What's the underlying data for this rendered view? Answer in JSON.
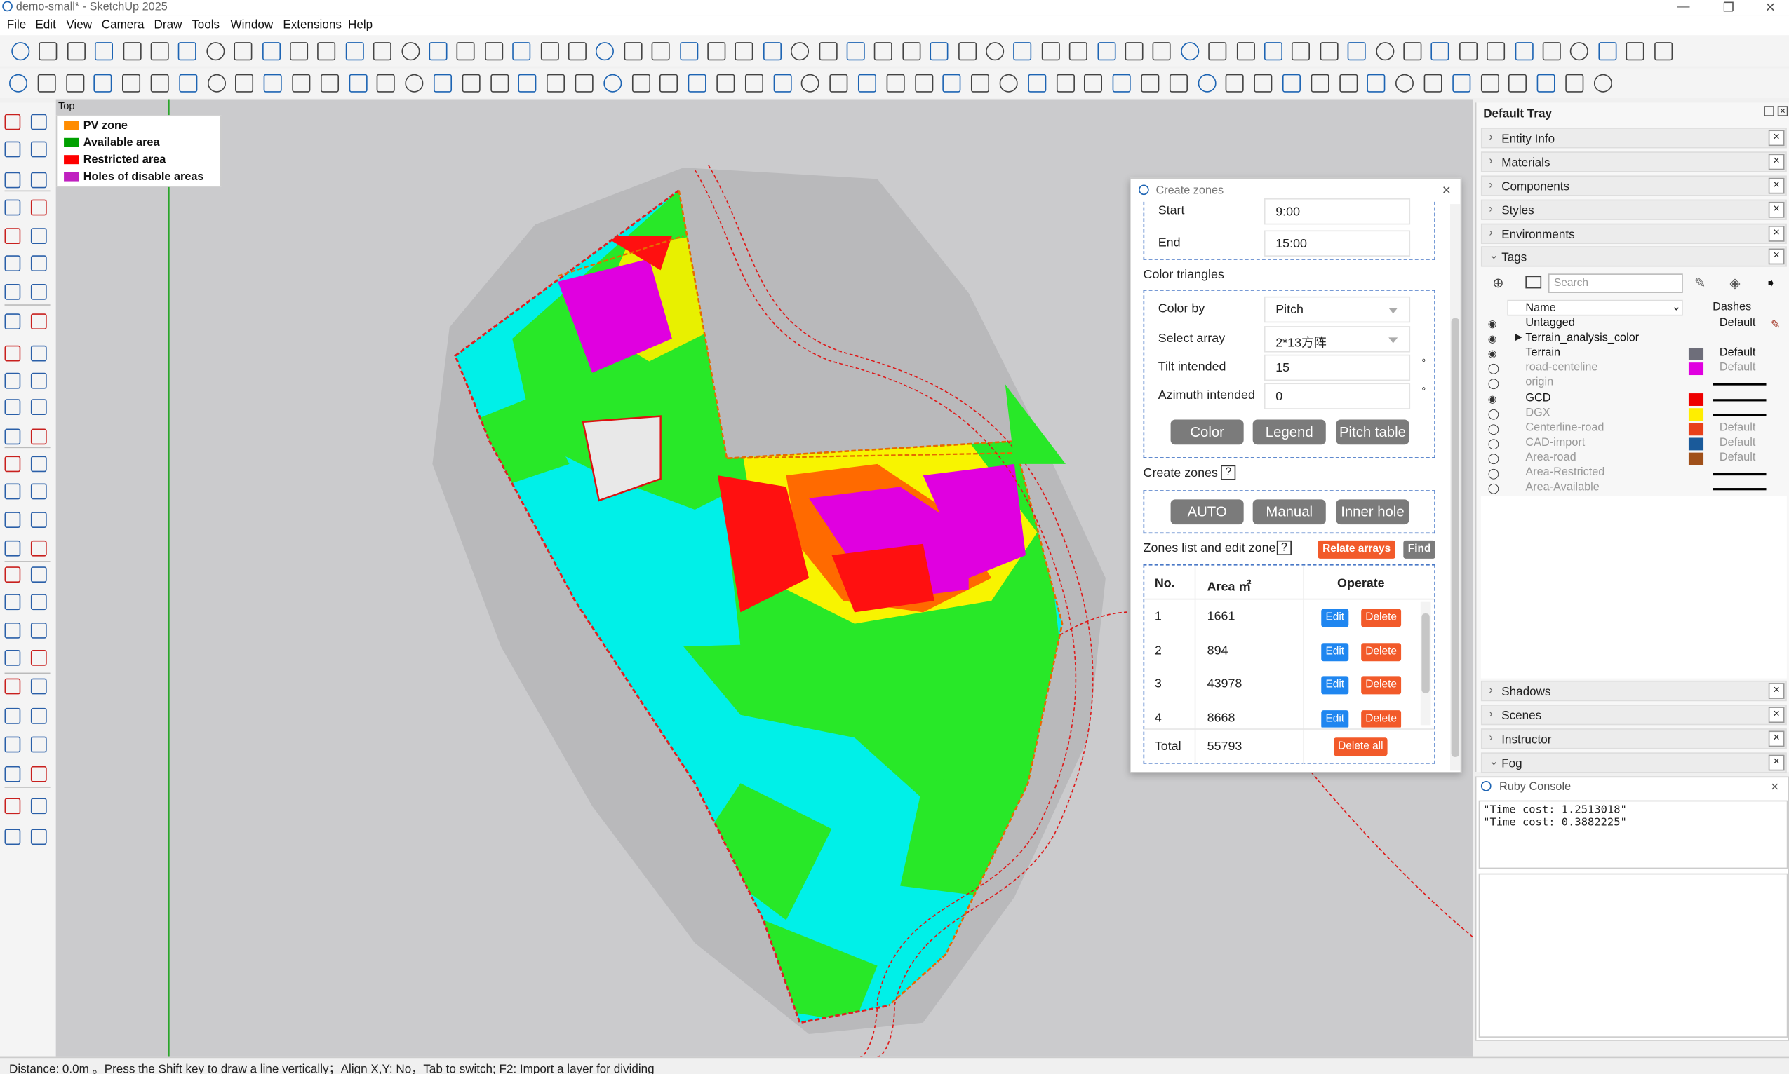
{
  "window": {
    "title": "demo-small* - SketchUp 2025",
    "controls": [
      "—",
      "❐",
      "✕"
    ]
  },
  "menu": [
    "File",
    "Edit",
    "View",
    "Camera",
    "Draw",
    "Tools",
    "Window",
    "Extensions",
    "Help"
  ],
  "viewport": {
    "view_label": "Top"
  },
  "legend": [
    {
      "label": "PV zone",
      "color": "#ff8c00"
    },
    {
      "label": "Available area",
      "color": "#00a000"
    },
    {
      "label": "Restricted area",
      "color": "#ff0000"
    },
    {
      "label": "Holes of disable areas",
      "color": "#c020c0"
    }
  ],
  "dialog": {
    "title": "Create zones",
    "start_label": "Start",
    "start_value": "9:00",
    "end_label": "End",
    "end_value": "15:00",
    "color_triangles_heading": "Color triangles",
    "color_by_label": "Color by",
    "color_by_value": "Pitch",
    "select_array_label": "Select array",
    "select_array_value": "2*13方阵",
    "tilt_label": "Tilt intended",
    "tilt_value": "15",
    "tilt_unit": "°",
    "azimuth_label": "Azimuth intended",
    "azimuth_value": "0",
    "azimuth_unit": "°",
    "color_button": "Color",
    "legend_button": "Legend",
    "pitch_table_button": "Pitch table",
    "create_zones_heading": "Create zones",
    "help": "?",
    "auto_button": "AUTO",
    "manual_button": "Manual",
    "inner_hole_button": "Inner hole",
    "zones_heading": "Zones list and edit zone",
    "relate_button": "Relate arrays",
    "find_button": "Find",
    "col_no": "No.",
    "col_area": "Area ㎡",
    "col_operate": "Operate",
    "rows": [
      {
        "no": "1",
        "area": "1661",
        "edit": "Edit",
        "del": "Delete"
      },
      {
        "no": "2",
        "area": "894",
        "edit": "Edit",
        "del": "Delete"
      },
      {
        "no": "3",
        "area": "43978",
        "edit": "Edit",
        "del": "Delete"
      },
      {
        "no": "4",
        "area": "8668",
        "edit": "Edit",
        "del": "Delete"
      }
    ],
    "total_label": "Total",
    "total_value": "55793",
    "delete_all": "Delete all"
  },
  "tray": {
    "title": "Default Tray",
    "sections_top": [
      "Entity Info",
      "Materials",
      "Components",
      "Styles",
      "Environments"
    ],
    "tags_label": "Tags",
    "search_placeholder": "Search",
    "col_name": "Name",
    "col_dashes": "Dashes",
    "tags": [
      {
        "name": "Untagged",
        "visible": true,
        "swatch": "",
        "dash": "Default"
      },
      {
        "name": "Terrain_analysis_color",
        "visible": true,
        "swatch": "",
        "dash": ""
      },
      {
        "name": "Terrain",
        "visible": true,
        "swatch": "#6e6e7a",
        "dash": "Default"
      },
      {
        "name": "road-centeline",
        "visible": false,
        "swatch": "#e000e0",
        "dash": "Default"
      },
      {
        "name": "origin",
        "visible": false,
        "swatch": "",
        "dash": ""
      },
      {
        "name": "GCD",
        "visible": true,
        "swatch": "#ee0000",
        "dash": ""
      },
      {
        "name": "DGX",
        "visible": false,
        "swatch": "#ffee00",
        "dash": ""
      },
      {
        "name": "Centerline-road",
        "visible": false,
        "swatch": "#e8401a",
        "dash": "Default"
      },
      {
        "name": "CAD-import",
        "visible": false,
        "swatch": "#1a5a9a",
        "dash": "Default"
      },
      {
        "name": "Area-road",
        "visible": false,
        "swatch": "#a0501a",
        "dash": "Default"
      },
      {
        "name": "Area-Restricted",
        "visible": false,
        "swatch": "",
        "dash": ""
      },
      {
        "name": "Area-Available",
        "visible": false,
        "swatch": "",
        "dash": ""
      }
    ],
    "sections_bottom": [
      "Shadows",
      "Scenes",
      "Instructor",
      "Fog"
    ]
  },
  "ruby": {
    "title": "Ruby Console",
    "lines": [
      "\"Time cost: 1.2513018\"",
      "\"Time cost: 0.3882225\""
    ]
  },
  "status": "Distance: 0.0m 。Press the Shift key to draw a line vertically；Align X,Y: No，Tab to switch;  F2: Import a layer for dividing"
}
